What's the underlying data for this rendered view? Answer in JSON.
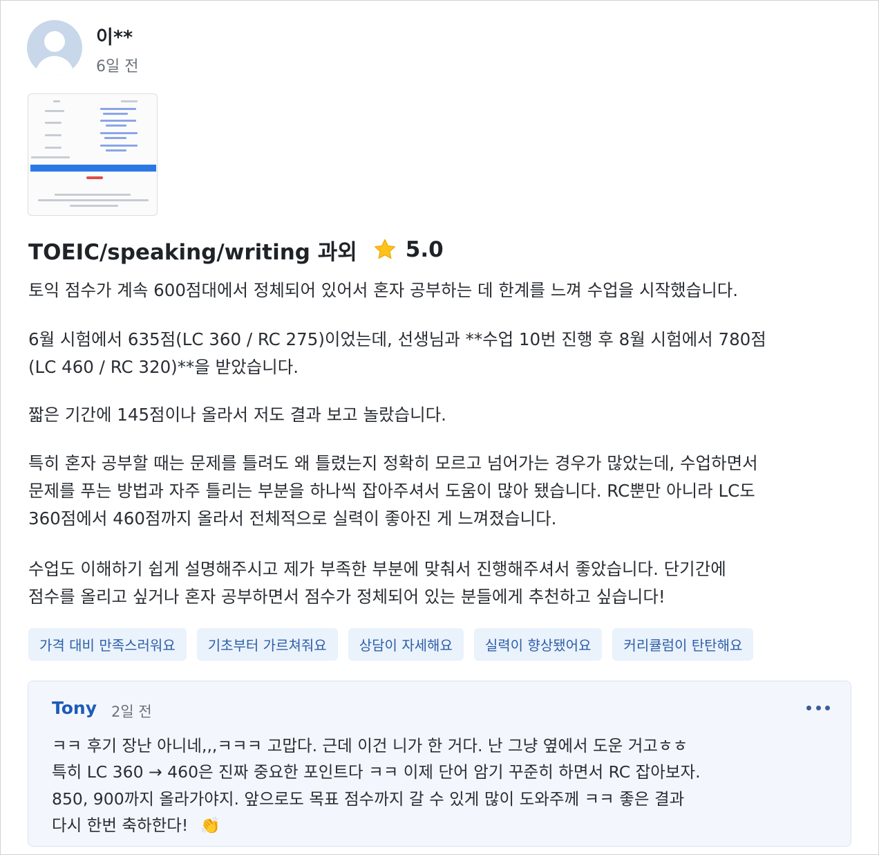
{
  "review": {
    "author": "이**",
    "date": "6일 전",
    "avatar_icon": "user-avatar-icon",
    "title": "TOEIC/speaking/writing 과외",
    "rating": "5.0",
    "rating_icon": "star-icon",
    "paragraphs": [
      [
        "토익 점수가 계속 600점대에서 정체되어 있어서 혼자 공부하는 데 한계를 느껴 수업을 시작했습니다."
      ],
      [
        "6월 시험에서 635점(LC 360 / RC 275)이었는데, 선생님과 **수업 10번 진행 후 8월 시험에서 780점",
        "(LC 460 / RC 320)**을 받았습니다."
      ],
      [
        "짧은 기간에 145점이나 올라서 저도 결과 보고 놀랐습니다."
      ],
      [
        "특히 혼자 공부할 때는 문제를 틀려도 왜 틀렸는지 정확히 모르고 넘어가는 경우가 많았는데, 수업하면서",
        "문제를 푸는 방법과 자주 틀리는 부분을 하나씩 잡아주셔서 도움이 많아 됐습니다. RC뿐만 아니라 LC도",
        "360점에서 460점까지 올라서 전체적으로 실력이 좋아진 게 느껴졌습니다."
      ],
      [
        "수업도 이해하기 쉽게 설명해주시고 제가 부족한 부분에 맞춰서 진행해주셔서 좋았습니다. 단기간에",
        "점수를 올리고 싶거나 혼자 공부하면서 점수가 정체되어 있는 분들에게 추천하고 싶습니다!"
      ]
    ],
    "tags": [
      "가격 대비 만족스러워요",
      "기초부터 가르쳐줘요",
      "상담이 자세해요",
      "실력이 향상됐어요",
      "커리큘럼이 탄탄해요"
    ]
  },
  "reply": {
    "name": "Tony",
    "date": "2일 전",
    "more_icon": "more-options-icon",
    "lines": [
      "ㅋㅋ 후기 장난 아니네,,,ㅋㅋㅋ 고맙다. 근데 이건 니가 한 거다. 난 그냥 옆에서 도운 거고ㅎㅎ",
      "특히 LC 360 → 460은 진짜 중요한 포인트다 ㅋㅋ 이제 단어 암기 꾸준히 하면서 RC 잡아보자.",
      "850, 900까지 올라가야지. 앞으로도 목표 점수까지 갈 수 있게 많이 도와주께 ㅋㅋ 좋은 결과",
      "다시 한번 축하한다!"
    ],
    "clap_emoji": "👏"
  }
}
